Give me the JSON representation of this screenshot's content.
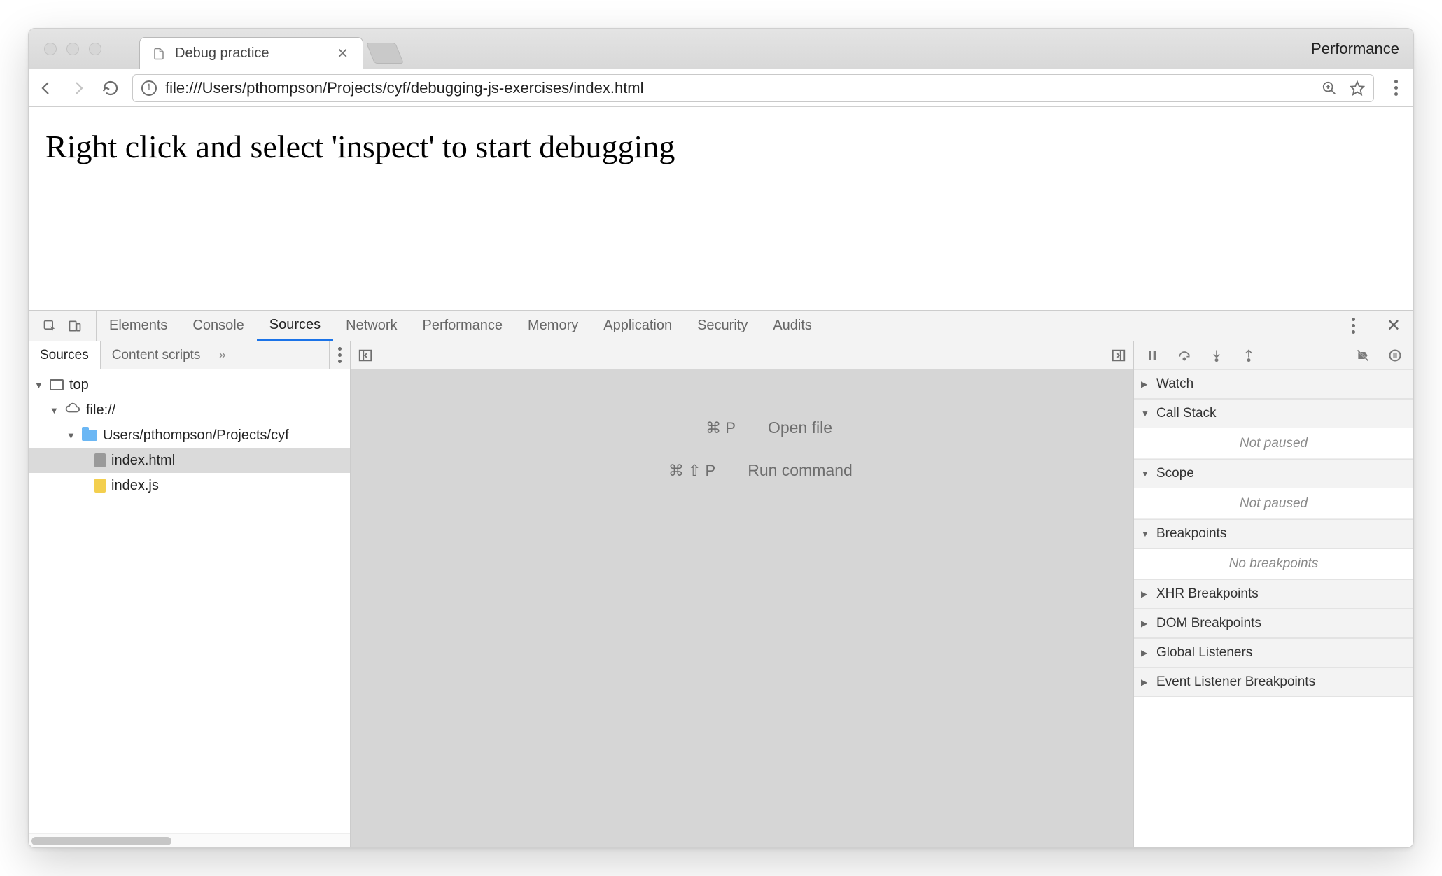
{
  "browser": {
    "tab_title": "Debug practice",
    "performance_label": "Performance",
    "url": "file:///Users/pthompson/Projects/cyf/debugging-js-exercises/index.html"
  },
  "page": {
    "heading": "Right click and select 'inspect' to start debugging"
  },
  "devtools": {
    "tabs": {
      "elements": "Elements",
      "console": "Console",
      "sources": "Sources",
      "network": "Network",
      "performance": "Performance",
      "memory": "Memory",
      "application": "Application",
      "security": "Security",
      "audits": "Audits"
    },
    "navigator": {
      "tabs": {
        "sources": "Sources",
        "content_scripts": "Content scripts"
      },
      "tree": {
        "top": "top",
        "origin": "file://",
        "folder": "Users/pthompson/Projects/cyf",
        "files": {
          "index_html": "index.html",
          "index_js": "index.js"
        }
      }
    },
    "editor": {
      "open_file_keys": "⌘ P",
      "open_file_label": "Open file",
      "run_command_keys": "⌘ ⇧ P",
      "run_command_label": "Run command"
    },
    "sidebar": {
      "sections": {
        "watch": "Watch",
        "call_stack": "Call Stack",
        "scope": "Scope",
        "breakpoints": "Breakpoints",
        "xhr": "XHR Breakpoints",
        "dom": "DOM Breakpoints",
        "global": "Global Listeners",
        "event": "Event Listener Breakpoints"
      },
      "not_paused": "Not paused",
      "no_breakpoints": "No breakpoints"
    }
  }
}
